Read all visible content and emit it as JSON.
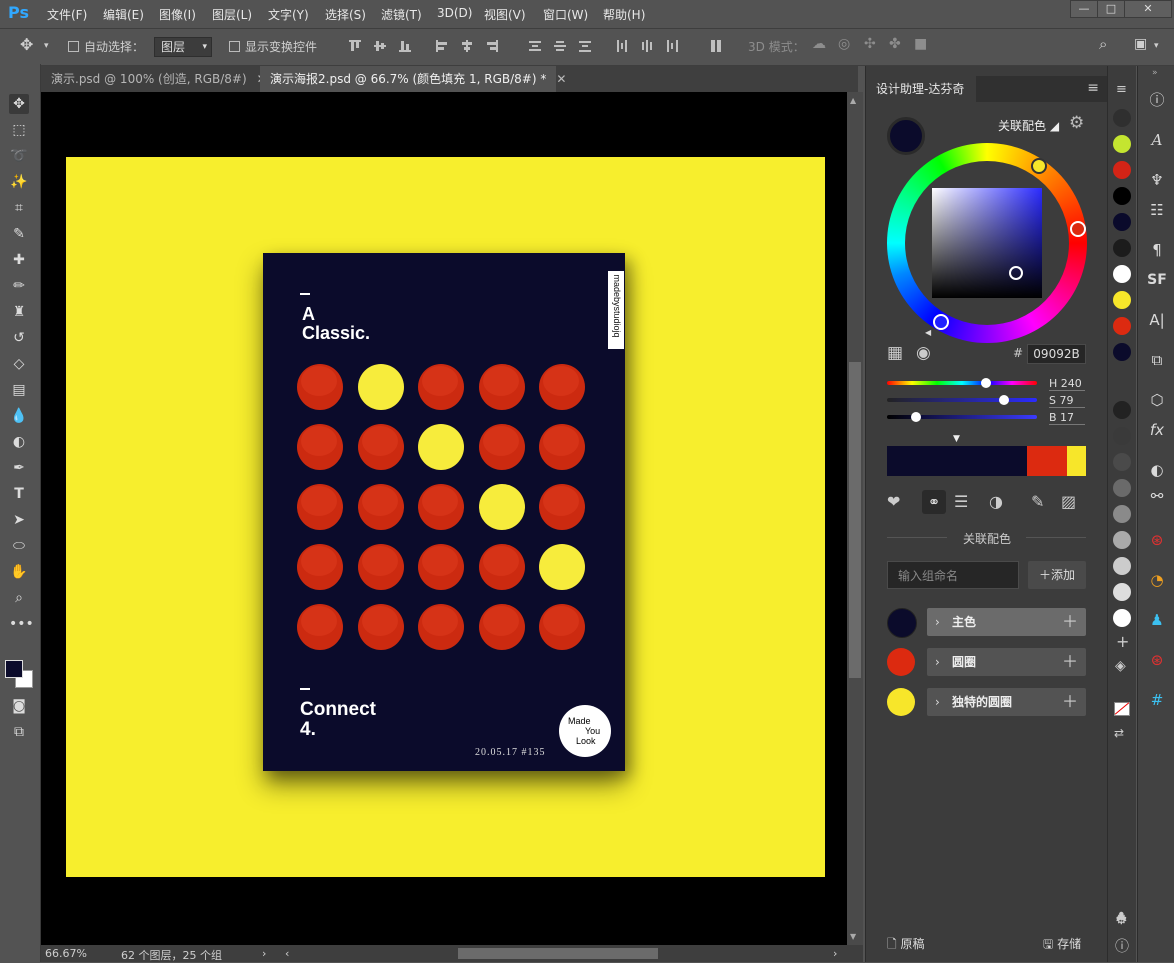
{
  "app": {
    "logo": "Ps"
  },
  "menu": [
    "文件(F)",
    "编辑(E)",
    "图像(I)",
    "图层(L)",
    "文字(Y)",
    "选择(S)",
    "滤镜(T)",
    "3D(D)",
    "视图(V)",
    "窗口(W)",
    "帮助(H)"
  ],
  "window_buttons": [
    "—",
    "□",
    "✕"
  ],
  "options": {
    "auto_select_label": "自动选择：",
    "auto_select_value": "图层",
    "show_transform_label": "显示变换控件",
    "mode_3d_label": "3D 模式："
  },
  "tabs": [
    {
      "label": "演示.psd @ 100% (创造, RGB/8#)",
      "close": "✕"
    },
    {
      "label": "演示海报2.psd @ 66.7% (颜色填充 1, RGB/8#) *",
      "close": "✕"
    }
  ],
  "poster": {
    "title_line1": "A",
    "title_line2": "Classic.",
    "side_tag": "madebystudiojq",
    "bottom_line1": "Connect",
    "bottom_line2": "4.",
    "stamp_line1": "Made",
    "stamp_line2": "You",
    "stamp_line3": "Look",
    "date": "20.05.17  #135",
    "grid": [
      [
        "r",
        "y",
        "r",
        "r",
        "r"
      ],
      [
        "r",
        "r",
        "y",
        "r",
        "r"
      ],
      [
        "r",
        "r",
        "r",
        "y",
        "r"
      ],
      [
        "r",
        "r",
        "r",
        "r",
        "y"
      ],
      [
        "r",
        "r",
        "r",
        "r",
        "r"
      ]
    ]
  },
  "status": {
    "zoom": "66.67%",
    "info": "62 个图层，25 个组"
  },
  "panel": {
    "tab": "设计助理-达芬奇",
    "assoc_dropdown": "关联配色",
    "hex_label": "#",
    "hex": "09092B",
    "h": "H 240",
    "s": "S 79",
    "b": "B 17",
    "section_title": "关联配色",
    "group_placeholder": "输入组命名",
    "add_button": "添加",
    "groups": [
      {
        "name": "主色",
        "color": "#0b0b2b"
      },
      {
        "name": "圆圈",
        "color": "#dc2a10"
      },
      {
        "name": "独特的圆圈",
        "color": "#f7e62a"
      }
    ],
    "footer_left": "原稿",
    "footer_right": "存储"
  },
  "colors": {
    "primary": "#09092B",
    "red": "#cc2a10",
    "yellow": "#f7ec3c",
    "artboard": "#f7ee2d"
  },
  "strip_swatches": [
    "#2f2f2f",
    "#c4e530",
    "#d42416",
    "#000000",
    "#0a0a2b",
    "#1c1c1c",
    "#ffffff",
    "#f7e62a",
    "#dc2a10",
    "#0b0b2b",
    "#222222",
    "#3a3a3a",
    "#4a4a4a",
    "#6a6a6a",
    "#8a8a8a",
    "#aaaaaa",
    "#cccccc",
    "#dddddd",
    "#ffffff"
  ],
  "icons": [
    "info-icon",
    "type-a-icon",
    "brush-settings-icon",
    "adjust-icon",
    "paragraph-icon",
    "sf-icon",
    "character-icon",
    "glyph-icon",
    "3d-icon",
    "fx-icon",
    "mask-icon",
    "links-icon",
    "target-icon",
    "gauge-icon",
    "people-icon",
    "target-icon",
    "grid-icon"
  ]
}
